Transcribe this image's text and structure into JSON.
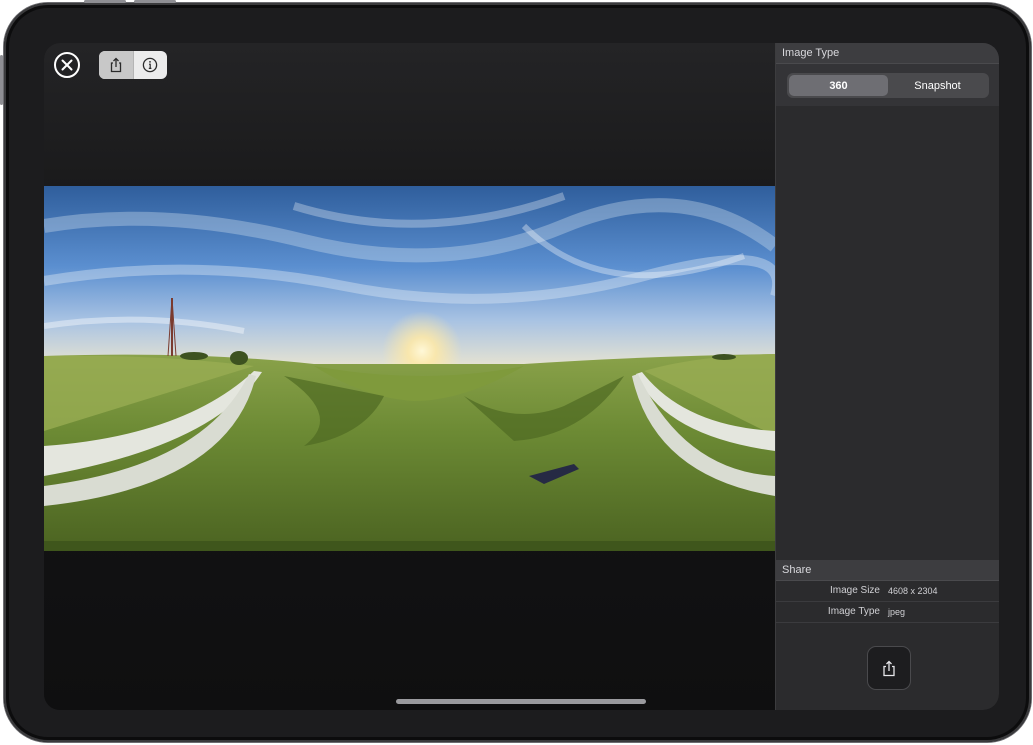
{
  "toolbar": {
    "close_icon": "close-circle-icon",
    "share_icon": "share-icon",
    "info_icon": "info-icon",
    "active_tool": "share"
  },
  "viewer": {
    "image_description_icon": "panorama-image",
    "accent_sky": "#4d7fc2",
    "accent_grass": "#6f8e34"
  },
  "sidebar": {
    "image_type_section": {
      "header": "Image Type",
      "options": [
        "360",
        "Snapshot"
      ],
      "selected": "360"
    },
    "share_section": {
      "header": "Share",
      "rows": [
        {
          "label": "Image Size",
          "value": "4608 x 2304"
        },
        {
          "label": "Image Type",
          "value": "jpeg"
        }
      ],
      "share_button_icon": "share-icon"
    }
  }
}
